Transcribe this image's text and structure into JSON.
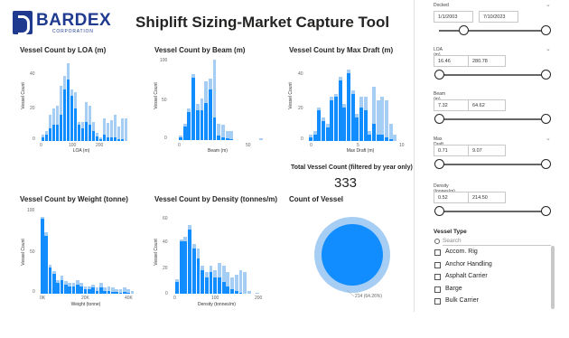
{
  "header": {
    "logo_name": "BARDEX",
    "logo_sub": "CORPORATION",
    "title": "Shiplift Sizing-Market Capture Tool"
  },
  "charts": {
    "loa": {
      "title": "Vessel Count by LOA (m)",
      "ylabel": "Vessel Count",
      "xlabel": "LOA (m)",
      "yticks": [
        "40",
        "20",
        "0"
      ],
      "xticks": [
        "0",
        "100",
        "200"
      ]
    },
    "beam": {
      "title": "Vessel Count by Beam (m)",
      "ylabel": "Vessel Count",
      "xlabel": "Beam (m)",
      "yticks": [
        "100",
        "50",
        "0"
      ],
      "xticks": [
        "0",
        "50"
      ]
    },
    "draft": {
      "title": "Vessel Count by Max Draft (m)",
      "ylabel": "Vessel Count",
      "xlabel": "Max Draft (m)",
      "yticks": [
        "40",
        "20",
        "0"
      ],
      "xticks": [
        "0",
        "5",
        "10"
      ]
    },
    "weight": {
      "title": "Vessel Count by Weight (tonne)",
      "ylabel": "Vessel Count",
      "xlabel": "Weight (tonne)",
      "yticks": [
        "100",
        "50",
        "0"
      ],
      "xticks": [
        "0K",
        "20K",
        "40K"
      ]
    },
    "density": {
      "title": "Vessel Count by Density (tonnes/m)",
      "ylabel": "Vessel Count",
      "xlabel": "Density (tonnes/m)",
      "yticks": [
        "60",
        "40",
        "20",
        "0"
      ],
      "xticks": [
        "0",
        "100",
        "200"
      ]
    },
    "count": {
      "title": "Total Vessel Count (filtered by year only)",
      "value": "333"
    },
    "donut": {
      "title": "Count of Vessel",
      "label": "214 (64.26%)"
    }
  },
  "filters": {
    "docked": {
      "label": "Docked",
      "from": "1/1/2003",
      "to": "7/10/2023",
      "low": 0.23,
      "high": 1.0
    },
    "loa": {
      "label": "LOA (m)",
      "from": "16.46",
      "to": "280.78",
      "low": 0.0,
      "high": 1.0
    },
    "beam": {
      "label": "Beam (m)",
      "from": "7.32",
      "to": "64.62",
      "low": 0.0,
      "high": 1.0
    },
    "draft": {
      "label": "Max Draft (m)",
      "from": "0.71",
      "to": "9.07",
      "low": 0.0,
      "high": 1.0
    },
    "density": {
      "label": "Density (tonnes/m)",
      "from": "0.52",
      "to": "214.50",
      "low": 0.0,
      "high": 1.0
    }
  },
  "vessel_type": {
    "label": "Vessel Type",
    "search_placeholder": "Search",
    "items": [
      "Accom. Rig",
      "Anchor Handling",
      "Asphalt Carrier",
      "Barge",
      "Bulk Carrier"
    ]
  },
  "colors": {
    "selected": "#118dff",
    "total": "#a6cdf4",
    "brand": "#1f3a8f"
  },
  "chart_data": [
    {
      "type": "bar",
      "title": "Vessel Count by LOA (m)",
      "xlabel": "LOA (m)",
      "ylabel": "Vessel Count",
      "ylim": [
        0,
        48
      ],
      "series": [
        {
          "values": [
            4,
            6,
            16,
            20,
            22,
            34,
            40,
            48,
            32,
            30,
            12,
            12,
            24,
            22,
            12,
            5,
            2,
            14,
            11,
            13,
            16,
            9,
            14,
            14
          ]
        },
        {
          "values": [
            2,
            4,
            8,
            10,
            10,
            16,
            32,
            38,
            28,
            20,
            10,
            8,
            12,
            10,
            6,
            3,
            1,
            4,
            2,
            2,
            2,
            1,
            1,
            0
          ]
        }
      ]
    },
    {
      "type": "bar",
      "title": "Vessel Count by Beam (m)",
      "xlabel": "Beam (m)",
      "ylabel": "Vessel Count",
      "ylim": [
        0,
        110
      ],
      "series": [
        {
          "values": [
            6,
            22,
            42,
            88,
            48,
            56,
            78,
            82,
            108,
            22,
            20,
            12,
            12,
            0,
            0,
            0,
            0,
            0,
            0,
            3
          ]
        },
        {
          "values": [
            4,
            18,
            38,
            84,
            40,
            40,
            50,
            68,
            30,
            6,
            4,
            2,
            1,
            0,
            0,
            0,
            0,
            0,
            0,
            0
          ]
        }
      ]
    },
    {
      "type": "bar",
      "title": "Vessel Count by Max Draft (m)",
      "xlabel": "Max Draft (m)",
      "ylabel": "Vessel Count",
      "ylim": [
        0,
        46
      ],
      "series": [
        {
          "values": [
            4,
            6,
            20,
            14,
            10,
            26,
            28,
            38,
            22,
            42,
            30,
            16,
            26,
            26,
            6,
            32,
            24,
            26,
            24,
            10,
            4
          ]
        },
        {
          "values": [
            2,
            4,
            18,
            12,
            8,
            24,
            26,
            36,
            20,
            40,
            28,
            14,
            20,
            18,
            4,
            10,
            4,
            4,
            2,
            1,
            0
          ]
        }
      ]
    },
    {
      "type": "bar",
      "title": "Vessel Count by Weight (tonne)",
      "xlabel": "Weight (tonne)",
      "ylabel": "Vessel Count",
      "ylim": [
        0,
        110
      ],
      "series": [
        {
          "values": [
            100,
            80,
            38,
            30,
            18,
            24,
            16,
            14,
            14,
            18,
            14,
            10,
            10,
            12,
            8,
            14,
            8,
            10,
            8,
            6,
            6,
            8,
            6,
            4
          ]
        },
        {
          "values": [
            98,
            76,
            34,
            26,
            14,
            18,
            12,
            10,
            10,
            12,
            10,
            6,
            6,
            8,
            4,
            8,
            4,
            4,
            2,
            2,
            1,
            2,
            1,
            0
          ]
        }
      ]
    },
    {
      "type": "bar",
      "title": "Vessel Count by Density (tonnes/m)",
      "xlabel": "Density (tonnes/m)",
      "ylabel": "Vessel Count",
      "ylim": [
        0,
        65
      ],
      "series": [
        {
          "values": [
            12,
            46,
            48,
            58,
            42,
            38,
            24,
            18,
            24,
            20,
            26,
            24,
            18,
            14,
            16,
            20,
            18,
            2,
            0,
            1
          ]
        },
        {
          "values": [
            10,
            44,
            44,
            54,
            38,
            30,
            20,
            14,
            18,
            14,
            14,
            10,
            6,
            4,
            2,
            1,
            0,
            0,
            0,
            0
          ]
        }
      ]
    },
    {
      "type": "pie",
      "title": "Count of Vessel",
      "values": [
        214,
        119
      ],
      "labels": [
        "214 (64.26%)",
        ""
      ]
    }
  ]
}
